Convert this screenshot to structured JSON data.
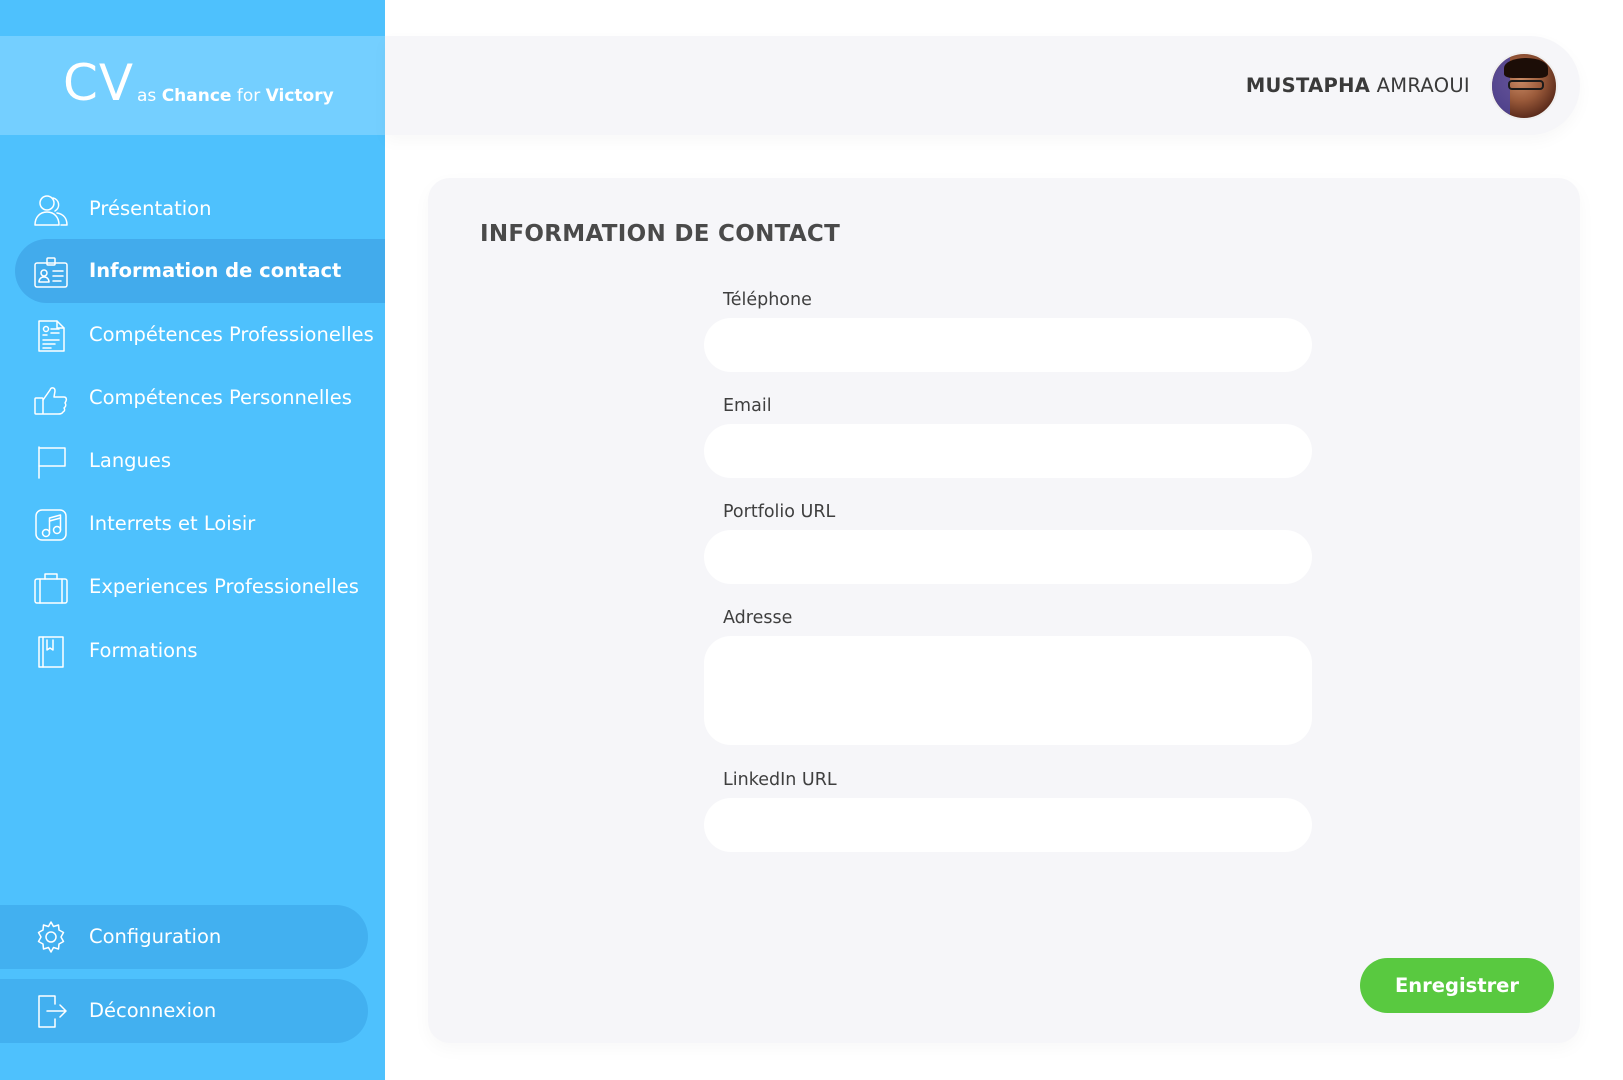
{
  "brand": {
    "logo_mark": "CV",
    "tag_prefix": "as",
    "tag_word1": "Chance",
    "tag_mid": "for",
    "tag_word2": "Victory"
  },
  "sidebar": {
    "items": [
      {
        "label": "Présentation",
        "icon": "users-icon",
        "active": false
      },
      {
        "label": "Information de contact",
        "icon": "id-card-icon",
        "active": true
      },
      {
        "label": "Compétences Professionelles",
        "icon": "document-icon",
        "active": false
      },
      {
        "label": "Compétences Personnelles",
        "icon": "thumbs-up-icon",
        "active": false
      },
      {
        "label": "Langues",
        "icon": "flag-icon",
        "active": false
      },
      {
        "label": "Interrets et Loisir",
        "icon": "music-icon",
        "active": false
      },
      {
        "label": "Experiences Professionelles",
        "icon": "briefcase-icon",
        "active": false
      },
      {
        "label": "Formations",
        "icon": "book-icon",
        "active": false
      }
    ],
    "bottom": [
      {
        "label": "Configuration",
        "icon": "gear-icon"
      },
      {
        "label": "Déconnexion",
        "icon": "logout-icon"
      }
    ]
  },
  "header": {
    "user_first": "MUSTAPHA",
    "user_last": "AMRAOUI"
  },
  "form": {
    "title": "INFORMATION DE CONTACT",
    "fields": [
      {
        "label": "Téléphone",
        "value": ""
      },
      {
        "label": "Email",
        "value": ""
      },
      {
        "label": "Portfolio URL",
        "value": ""
      },
      {
        "label": "Adresse",
        "value": ""
      },
      {
        "label": "LinkedIn URL",
        "value": ""
      }
    ],
    "save_label": "Enregistrer"
  },
  "colors": {
    "sidebar": "#4ec1fd",
    "sidebar_active": "#42abec",
    "accent_green": "#59c940",
    "card": "#f6f6f9"
  }
}
